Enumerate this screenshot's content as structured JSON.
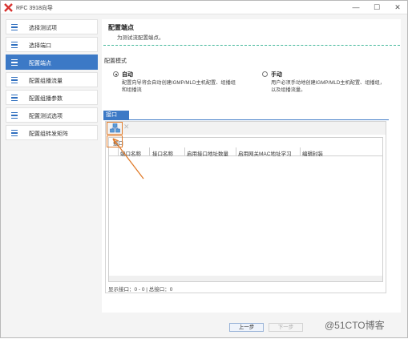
{
  "window": {
    "title": "RFC 3918向导",
    "controls": {
      "minimize": "—",
      "maximize": "☐",
      "close": "✕"
    }
  },
  "sidebar": {
    "items": [
      {
        "label": "选择测试项",
        "active": false
      },
      {
        "label": "选择端口",
        "active": false
      },
      {
        "label": "配置端点",
        "active": true
      },
      {
        "label": "配置组播流量",
        "active": false
      },
      {
        "label": "配置组播参数",
        "active": false
      },
      {
        "label": "配置测试选项",
        "active": false
      },
      {
        "label": "配置组转发矩阵",
        "active": false
      }
    ]
  },
  "main": {
    "title": "配置端点",
    "subtitle": "为测试流配置端点。",
    "mode_label": "配置模式",
    "options": [
      {
        "title": "自动",
        "desc_line1": "配置向导将会自动创建IGMP/MLD主机配置、组播组",
        "desc_line2": "和组播流",
        "selected": true
      },
      {
        "title": "手动",
        "desc_line1": "用户必须手动地创建IGMP/MLD主机配置、组播组，",
        "desc_line2": "以及组播流量。",
        "selected": false
      }
    ],
    "tab_label": "接口",
    "toolbar": {
      "add_icon": "add-interface-icon",
      "delete_icon": "delete-icon",
      "delete_glyph": "✕"
    },
    "table": {
      "header_left": "接口",
      "columns": [
        "端口名称",
        "接口名称",
        "启用接口地址数量",
        "启用网关MAC地址学习",
        "编辑封装"
      ]
    },
    "status_text": "显示接口：0 - 0 | 总接口：0"
  },
  "footer": {
    "prev_label": "上一步",
    "next_label": "下一步"
  },
  "watermark": "@51CTO博客",
  "colors": {
    "accent": "#3c79c6",
    "highlight": "#e07b2a",
    "divider": "#43b89a"
  }
}
